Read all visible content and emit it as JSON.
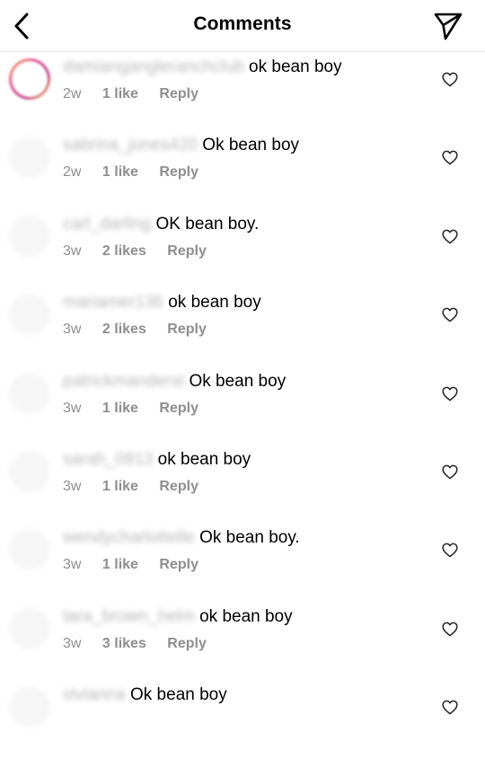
{
  "header": {
    "title": "Comments",
    "back_icon": "chevron-left-icon",
    "share_icon": "paper-plane-icon"
  },
  "comments": [
    {
      "username": "damiangangleranchclub",
      "text": "ok bean boy",
      "age": "2w",
      "likes": "1 like",
      "reply": "Reply"
    },
    {
      "username": "sabrina_jones420",
      "text": "Ok bean boy",
      "age": "2w",
      "likes": "1 like",
      "reply": "Reply"
    },
    {
      "username": "carl_darling",
      "text": "OK bean boy.",
      "age": "3w",
      "likes": "2 likes",
      "reply": "Reply"
    },
    {
      "username": "mariamer136",
      "text": "ok bean boy",
      "age": "3w",
      "likes": "2 likes",
      "reply": "Reply"
    },
    {
      "username": "patrickmanderst",
      "text": "Ok bean boy",
      "age": "3w",
      "likes": "1 like",
      "reply": "Reply"
    },
    {
      "username": "sarah_0913",
      "text": "ok bean boy",
      "age": "3w",
      "likes": "1 like",
      "reply": "Reply"
    },
    {
      "username": "wendycharlottelle",
      "text": "Ok bean boy.",
      "age": "3w",
      "likes": "1 like",
      "reply": "Reply"
    },
    {
      "username": "tara_brown_helm",
      "text": "ok bean boy",
      "age": "3w",
      "likes": "3 likes",
      "reply": "Reply"
    },
    {
      "username": "vivianna",
      "text": "Ok bean boy",
      "age": "",
      "likes": "",
      "reply": ""
    }
  ]
}
